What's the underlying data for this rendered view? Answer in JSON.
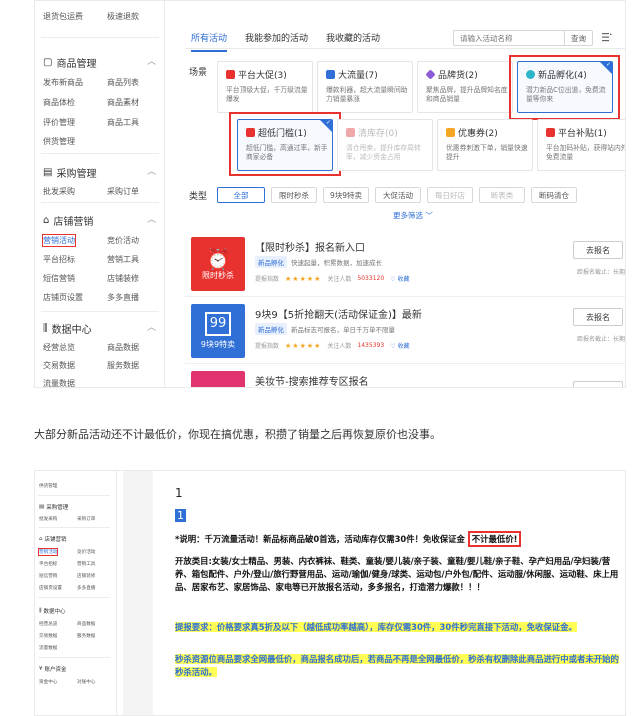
{
  "top_screenshot": {
    "sidebar": {
      "top_links": [
        "退货包运费",
        "极速退款"
      ],
      "sections": [
        {
          "title": "商品管理",
          "icon": "bag-icon",
          "links": [
            "发布新商品",
            "商品列表",
            "商品体检",
            "商品素材",
            "评价管理",
            "商品工具",
            "供货管理"
          ]
        },
        {
          "title": "采购管理",
          "icon": "cart-icon",
          "links": [
            "批发采购",
            "采购订单"
          ]
        },
        {
          "title": "店铺营销",
          "icon": "shop-icon",
          "links": [
            "营销活动",
            "竞价活动",
            "平台招标",
            "营销工具",
            "短信营销",
            "店铺装修",
            "店铺页设置",
            "多多直播"
          ]
        },
        {
          "title": "数据中心",
          "icon": "chart-icon",
          "links": [
            "经营总览",
            "商品数据",
            "交易数据",
            "服务数据",
            "流量数据"
          ]
        }
      ],
      "active_link": "营销活动"
    },
    "tabs": [
      "所有活动",
      "我能参加的活动",
      "我收藏的活动"
    ],
    "search": {
      "placeholder": "请输入活动名称",
      "button": "查询"
    },
    "scene_label": "场景",
    "type_label": "类型",
    "cards": [
      {
        "title": "平台大促(3)",
        "desc": "平台顶级大促，千万级流量爆发",
        "icon_color": "#e8322f",
        "state": "normal"
      },
      {
        "title": "大流量(7)",
        "desc": "爆款利器，超大流量瞬间助力销量暴涨",
        "icon_color": "#2f6fd6",
        "state": "normal"
      },
      {
        "title": "品牌货(2)",
        "desc": "聚焦品牌，提升品牌知名度和商品销量",
        "icon_color": "#8e5bd6",
        "state": "normal"
      },
      {
        "title": "新品孵化(4)",
        "desc": "潜力新品C位出道，免费流量等你来",
        "icon_color": "#2cb5c9",
        "state": "selected"
      },
      {
        "title": "超低门槛(1)",
        "desc": "超低门槛，高通过率，新手商家必备",
        "icon_color": "#e8322f",
        "state": "selected"
      },
      {
        "title": "清库存(0)",
        "desc": "清仓甩卖，提升库存周转率，减少资金占用",
        "icon_color": "#f0a7a7",
        "state": "disabled"
      },
      {
        "title": "优惠券(2)",
        "desc": "优惠券刺激下单，销量快速提升",
        "icon_color": "#f5a623",
        "state": "normal"
      },
      {
        "title": "平台补贴(1)",
        "desc": "平台加码补贴，获得站内外免费流量",
        "icon_color": "#e8322f",
        "state": "normal"
      }
    ],
    "types": [
      "全部",
      "限时秒杀",
      "9块9特卖",
      "大促活动",
      "每日好店",
      "断表类",
      "断码清仓"
    ],
    "more_filters": "更多筛选 ﹀",
    "activities": [
      {
        "thumb": "限时秒杀",
        "thumb_color": "#e8322f",
        "title": "【限时秒杀】报名新入口",
        "tag": "新品孵化",
        "desc": "快速起量，积累数据，加速成长",
        "rating_label": "提报指数",
        "stars": "★★★★★",
        "followers_label": "关注人数",
        "followers": "5033120",
        "fav": "收藏",
        "button": "去报名",
        "deadline": "距报名截止：长期"
      },
      {
        "thumb": "9块9特卖",
        "thumb_color": "#2f6fd6",
        "title": "9块9【5折抢翻天(活动保证金)】最新",
        "tag": "新品孵化",
        "desc": "新品标志可报名，单日千万单不限量",
        "rating_label": "提报指数",
        "stars": "★★★★★",
        "followers_label": "关注人数",
        "followers": "1435393",
        "fav": "收藏",
        "button": "去报名",
        "deadline": "距报名截止：长期"
      },
      {
        "thumb": "",
        "thumb_color": "#e0336f",
        "title": "美妆节-搜索推荐专区报名",
        "tag": "",
        "desc": "",
        "rating_label": "",
        "stars": "",
        "followers_label": "",
        "followers": "",
        "fav": "",
        "button": "",
        "deadline": ""
      }
    ]
  },
  "caption": "大部分新品活动还不计最低价，你现在搞优惠，积攒了销量之后再恢复原价也没事。",
  "bottom_screenshot": {
    "sidebar": {
      "top_links": [
        "供货管理"
      ],
      "sections": [
        {
          "title": "采购管理",
          "links": [
            "批发采购",
            "采购订单"
          ]
        },
        {
          "title": "店铺营销",
          "links": [
            "营销活动",
            "竞价活动",
            "平台招标",
            "营销工具",
            "短信营销",
            "店铺装修",
            "店铺页设置",
            "多多直播"
          ]
        },
        {
          "title": "数据中心",
          "links": [
            "经营总览",
            "商品数据",
            "交易数据",
            "服务数据",
            "流量数据"
          ]
        },
        {
          "title": "账户资金",
          "links": [
            "资金中心",
            "对账中心"
          ]
        }
      ]
    },
    "doc": {
      "line1": "1",
      "line2": "1",
      "p1_a": "*说明：千万流量活动！新品标商品破0首选，活动库存仅需30件！免收保证金",
      "p1_b": "不计最低价!",
      "p2": "开放类目:女装/女士精品、男装、内衣裤袜、鞋类、童装/婴儿装/亲子装、童鞋/婴儿鞋/亲子鞋、孕产妇用品/孕妇装/营养、箱包配件、户外/登山/旅行野营用品、运动/瑜伽/健身/球类、运动包/户外包/配件、运动服/休闲服、运动鞋、床上用品、居家布艺、家居饰品、家电等已开放报名活动，多多报名，打造潜力爆款！！！",
      "p3": "提报要求：价格要求真5折及以下（越低成功率越高），库存仅需30件，30件秒完直接下活动，免收保证金。",
      "p4": "秒杀资源位商品要求全网最低价，商品报名成功后，若商品不再是全网最低价，秒杀有权删除此商品进行中或者未开始的秒杀活动。"
    }
  }
}
